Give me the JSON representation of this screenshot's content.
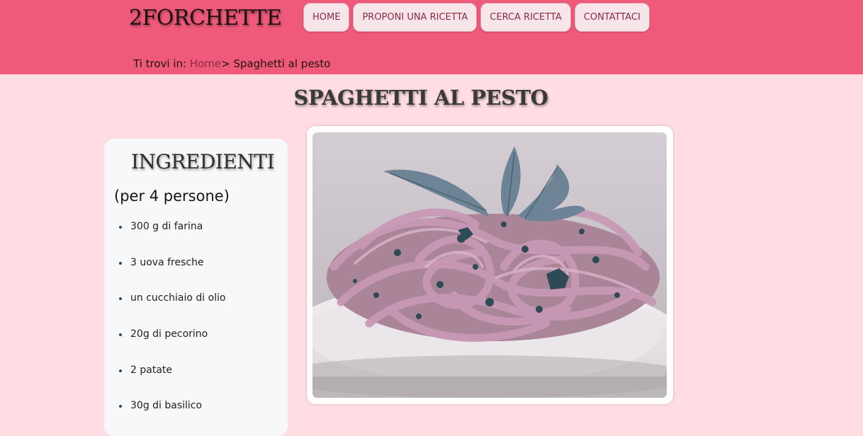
{
  "site": {
    "logo": "2FORCHETTE"
  },
  "nav": {
    "home": "HOME",
    "propose": "PROPONI UNA RICETTA",
    "search": "CERCA RICETTA",
    "contact": "CONTATTACI"
  },
  "breadcrumb": {
    "prefix": "Ti trovi in: ",
    "home": "Home",
    "current": "> Spaghetti al pesto"
  },
  "page": {
    "title": "SPAGHETTI AL PESTO"
  },
  "ingredients": {
    "title": "INGREDIENTI",
    "servings": "(per 4 persone)",
    "items": [
      "300 g di farina",
      "3 uova fresche",
      "un cucchiaio di olio",
      "20g di pecorino",
      "2 patate",
      "30g di basilico"
    ]
  },
  "photo": {
    "alt": "Spaghetti al pesto"
  }
}
